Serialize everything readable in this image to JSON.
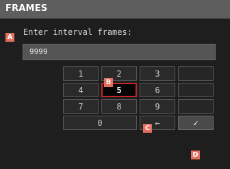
{
  "title": "FRAMES",
  "prompt": "Enter interval frames:",
  "field": {
    "value": "9999"
  },
  "keys": {
    "k1": "1",
    "k2": "2",
    "k3": "3",
    "k4": "4",
    "k5": "5",
    "k6": "6",
    "k7": "7",
    "k8": "8",
    "k9": "9",
    "k0": "0",
    "backspace": "←",
    "confirm": "✓"
  },
  "markers": {
    "a": "A",
    "b": "B",
    "c": "C",
    "d": "D"
  },
  "colors": {
    "selection_border": "#c8242b",
    "marker_bg": "#e36f5c",
    "title_bar": "#5e5e5e",
    "background": "#1e1e1e"
  }
}
